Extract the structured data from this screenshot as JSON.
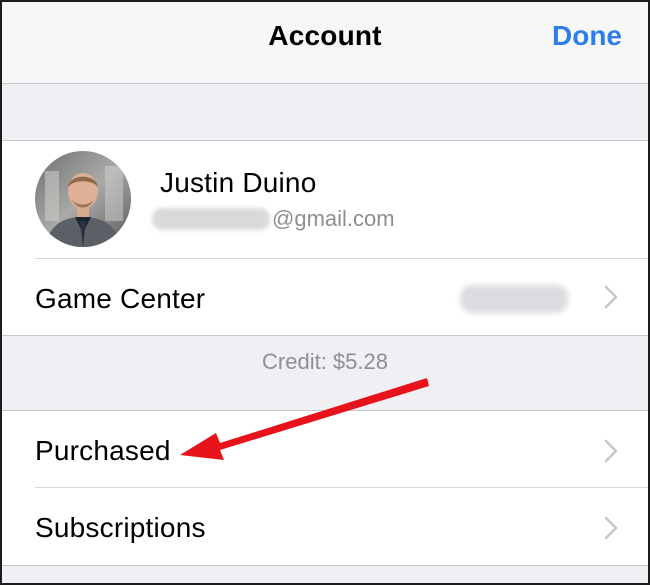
{
  "navbar": {
    "title": "Account",
    "done_label": "Done"
  },
  "profile": {
    "name": "Justin Duino",
    "email_domain": "@gmail.com"
  },
  "rows": {
    "game_center": "Game Center",
    "purchased": "Purchased",
    "subscriptions": "Subscriptions"
  },
  "credit": {
    "text": "Credit: $5.28"
  },
  "colors": {
    "accent": "#2f7ee8",
    "annotation_arrow": "#e8121a",
    "background": "#efeff4"
  }
}
